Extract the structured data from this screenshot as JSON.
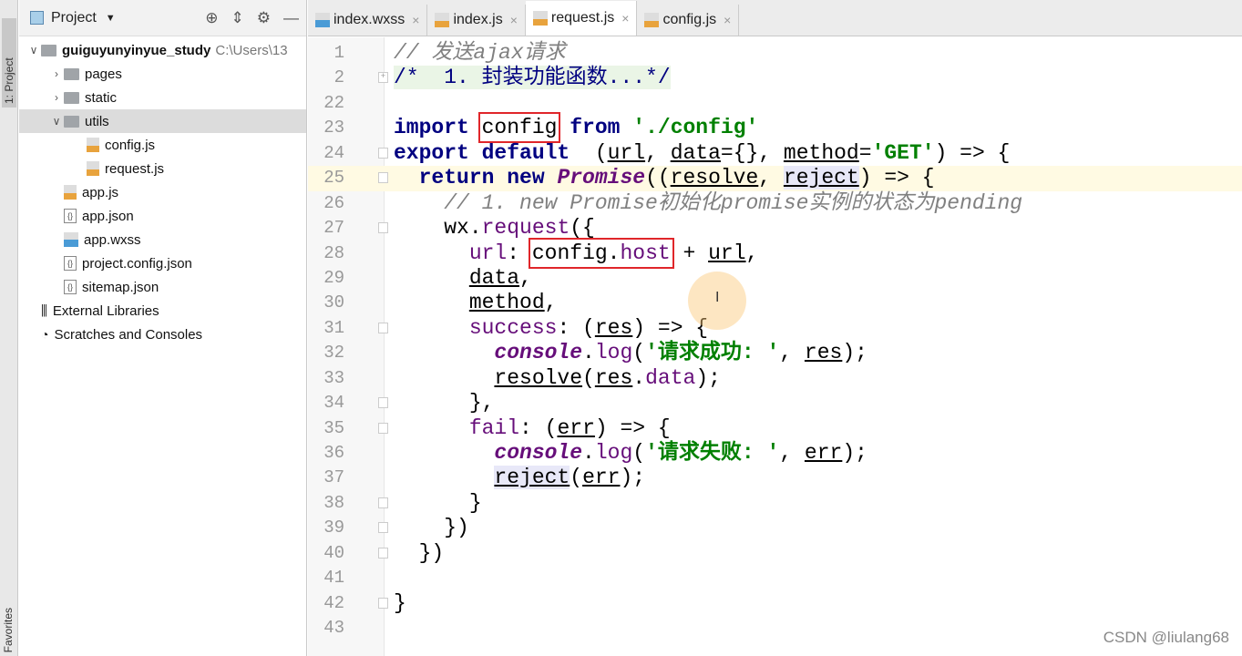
{
  "sidebar": {
    "strip_label": "1: Project",
    "favorites_label": "Favorites",
    "title": "Project",
    "tree": [
      {
        "label": "guiguyunyinyue_study",
        "path": "C:\\Users\\13",
        "icon": "folder",
        "depth": 0,
        "arrow": "v",
        "bold": true
      },
      {
        "label": "pages",
        "icon": "folder",
        "depth": 1,
        "arrow": ">"
      },
      {
        "label": "static",
        "icon": "folder",
        "depth": 1,
        "arrow": ">"
      },
      {
        "label": "utils",
        "icon": "folder",
        "depth": 1,
        "arrow": "v",
        "selected": true
      },
      {
        "label": "config.js",
        "icon": "js",
        "depth": 2
      },
      {
        "label": "request.js",
        "icon": "js",
        "depth": 2
      },
      {
        "label": "app.js",
        "icon": "js",
        "depth": 1
      },
      {
        "label": "app.json",
        "icon": "json",
        "depth": 1
      },
      {
        "label": "app.wxss",
        "icon": "css",
        "depth": 1
      },
      {
        "label": "project.config.json",
        "icon": "json",
        "depth": 1
      },
      {
        "label": "sitemap.json",
        "icon": "json",
        "depth": 1
      },
      {
        "label": "External Libraries",
        "icon": "library",
        "depth": 0
      },
      {
        "label": "Scratches and Consoles",
        "icon": "scratches",
        "depth": 0
      }
    ]
  },
  "tabs": [
    {
      "label": "index.wxss",
      "icon": "css"
    },
    {
      "label": "index.js",
      "icon": "js"
    },
    {
      "label": "request.js",
      "icon": "js",
      "active": true
    },
    {
      "label": "config.js",
      "icon": "js"
    }
  ],
  "code": [
    {
      "n": "1",
      "t": [
        [
          "cm",
          "// 发送ajax请求"
        ]
      ]
    },
    {
      "n": "2",
      "fold": "+",
      "t": [
        [
          "cmf",
          "/*  1. 封装功能函数...*/"
        ]
      ]
    },
    {
      "n": "22",
      "t": []
    },
    {
      "n": "23",
      "t": [
        [
          "kw",
          "import "
        ],
        [
          "box",
          "config"
        ],
        [
          "kw",
          " from "
        ],
        [
          "str",
          "'./config'"
        ]
      ]
    },
    {
      "n": "24",
      "fold": "-",
      "t": [
        [
          "kw",
          "export default  "
        ],
        [
          "",
          "("
        ],
        [
          "ul",
          "url"
        ],
        [
          "",
          ", "
        ],
        [
          "ul",
          "data"
        ],
        [
          "",
          "={}, "
        ],
        [
          "ul",
          "method"
        ],
        [
          "",
          "="
        ],
        [
          "str",
          "'GET'"
        ],
        [
          "",
          ") => {"
        ]
      ]
    },
    {
      "n": "25",
      "fold": "-",
      "cur": true,
      "t": [
        [
          "",
          "  "
        ],
        [
          "kw",
          "return new "
        ],
        [
          "fn",
          "Promise"
        ],
        [
          "",
          "(("
        ],
        [
          "ul",
          "resolve"
        ],
        [
          "",
          ", "
        ],
        [
          "ul hl",
          "reject"
        ],
        [
          "",
          ") => {"
        ]
      ]
    },
    {
      "n": "26",
      "t": [
        [
          "cm",
          "    // 1. new Promise初始化promise实例的状态为pending"
        ]
      ]
    },
    {
      "n": "27",
      "fold": "-",
      "t": [
        [
          "",
          "    wx."
        ],
        [
          "prop",
          "request"
        ],
        [
          "",
          "({"
        ]
      ]
    },
    {
      "n": "28",
      "t": [
        [
          "",
          "      "
        ],
        [
          "prop",
          "url"
        ],
        [
          "",
          ": "
        ],
        [
          "box",
          "config.<p>host</p>"
        ],
        [
          "",
          " + "
        ],
        [
          "ul",
          "url"
        ],
        [
          "",
          ","
        ]
      ]
    },
    {
      "n": "29",
      "t": [
        [
          "",
          "      "
        ],
        [
          "ul",
          "data"
        ],
        [
          "",
          ","
        ]
      ]
    },
    {
      "n": "30",
      "t": [
        [
          "",
          "      "
        ],
        [
          "ul",
          "method"
        ],
        [
          "",
          ","
        ]
      ]
    },
    {
      "n": "31",
      "fold": "-",
      "t": [
        [
          "cm",
          "      "
        ],
        [
          "prop",
          "success"
        ],
        [
          "",
          ": ("
        ],
        [
          "ul",
          "res"
        ],
        [
          "",
          ") => {"
        ]
      ]
    },
    {
      "n": "32",
      "t": [
        [
          "",
          "        "
        ],
        [
          "fld",
          "console"
        ],
        [
          "",
          "."
        ],
        [
          "prop",
          "log"
        ],
        [
          "",
          "("
        ],
        [
          "str",
          "'请求成功: '"
        ],
        [
          "",
          ", "
        ],
        [
          "ul",
          "res"
        ],
        [
          "",
          ");"
        ]
      ]
    },
    {
      "n": "33",
      "t": [
        [
          "",
          "        "
        ],
        [
          "ul",
          "resolve"
        ],
        [
          "",
          "("
        ],
        [
          "ul",
          "res"
        ],
        [
          "",
          "."
        ],
        [
          "prop",
          "data"
        ],
        [
          "",
          ");"
        ]
      ]
    },
    {
      "n": "34",
      "fold": "-",
      "t": [
        [
          "",
          "      },"
        ]
      ]
    },
    {
      "n": "35",
      "fold": "-",
      "t": [
        [
          "",
          "      "
        ],
        [
          "prop",
          "fail"
        ],
        [
          "",
          ": ("
        ],
        [
          "ul",
          "err"
        ],
        [
          "",
          ") => {"
        ]
      ]
    },
    {
      "n": "36",
      "t": [
        [
          "",
          "        "
        ],
        [
          "fld",
          "console"
        ],
        [
          "",
          "."
        ],
        [
          "prop",
          "log"
        ],
        [
          "",
          "("
        ],
        [
          "str",
          "'请求失败: '"
        ],
        [
          "",
          ", "
        ],
        [
          "ul",
          "err"
        ],
        [
          "",
          ");"
        ]
      ]
    },
    {
      "n": "37",
      "t": [
        [
          "",
          "        "
        ],
        [
          "ul hl",
          "reject"
        ],
        [
          "",
          "("
        ],
        [
          "ul",
          "err"
        ],
        [
          "",
          ");"
        ]
      ]
    },
    {
      "n": "38",
      "fold": "-",
      "t": [
        [
          "",
          "      }"
        ]
      ]
    },
    {
      "n": "39",
      "fold": "-",
      "t": [
        [
          "",
          "    })"
        ]
      ]
    },
    {
      "n": "40",
      "fold": "-",
      "t": [
        [
          "",
          "  })"
        ]
      ]
    },
    {
      "n": "41",
      "t": []
    },
    {
      "n": "42",
      "fold": "-",
      "t": [
        [
          "",
          "}"
        ]
      ]
    },
    {
      "n": "43",
      "t": []
    }
  ],
  "watermark": "CSDN @liulang68",
  "colors": {
    "keyword": "#000080",
    "string": "#008000",
    "comment": "#808080",
    "property": "#660e7a",
    "highlight_box": "#e0262a"
  }
}
